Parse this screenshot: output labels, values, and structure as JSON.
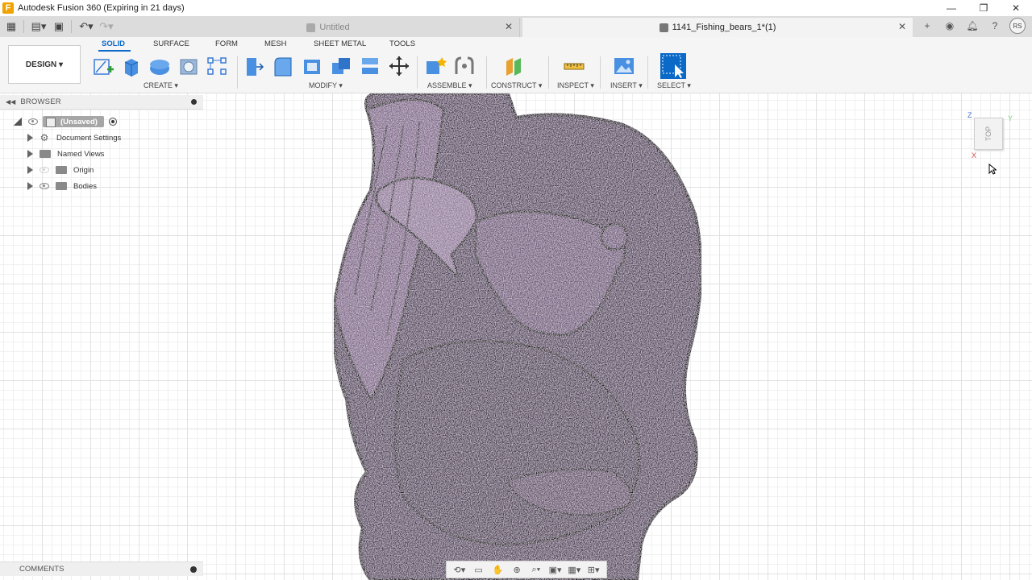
{
  "window": {
    "title": "Autodesk Fusion 360 (Expiring in 21 days)",
    "logo": "F"
  },
  "tabs": [
    {
      "label": "Untitled",
      "active": false
    },
    {
      "label": "1141_Fishing_bears_1*(1)",
      "active": true
    }
  ],
  "user": {
    "initials": "RS"
  },
  "workspace": {
    "label": "DESIGN"
  },
  "ribbon_tabs": [
    "SOLID",
    "SURFACE",
    "FORM",
    "MESH",
    "SHEET METAL",
    "TOOLS"
  ],
  "ribbon_groups": {
    "create": "CREATE",
    "modify": "MODIFY",
    "assemble": "ASSEMBLE",
    "construct": "CONSTRUCT",
    "inspect": "INSPECT",
    "insert": "INSERT",
    "select": "SELECT"
  },
  "browser": {
    "title": "BROWSER",
    "root": "(Unsaved)",
    "items": [
      "Document Settings",
      "Named Views",
      "Origin",
      "Bodies"
    ]
  },
  "viewcube": {
    "face": "TOP",
    "z": "Z",
    "x": "X",
    "y": "Y"
  },
  "comments": {
    "label": "COMMENTS"
  },
  "colors": {
    "accent": "#0b69c7",
    "model": "#5a4660"
  }
}
